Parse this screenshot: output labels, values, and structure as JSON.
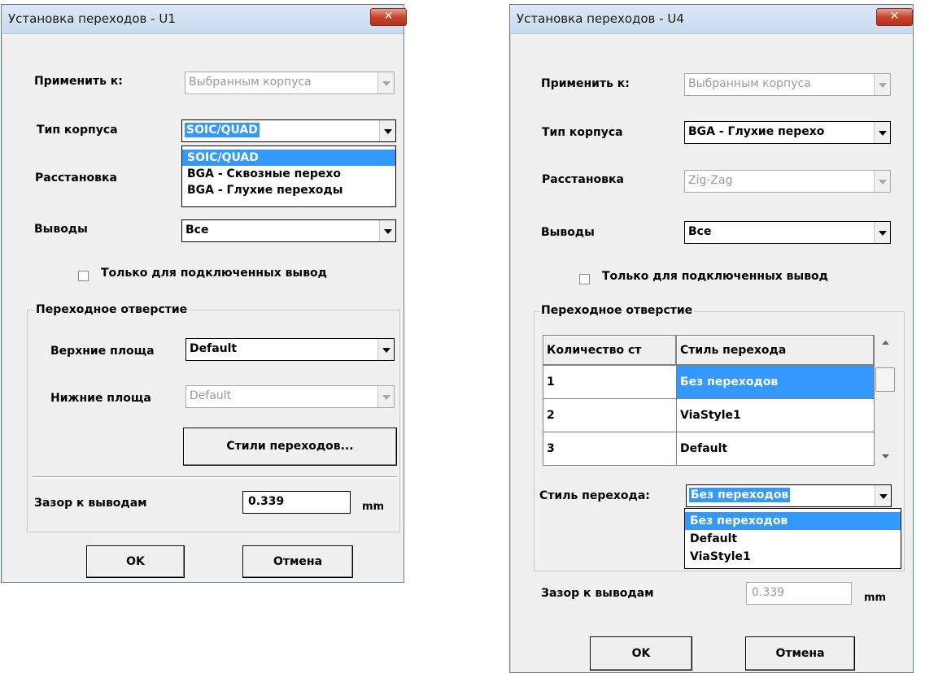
{
  "left_dialog": {
    "title": "Установка переходов - U1",
    "close_label": "✕",
    "apply_to": {
      "label": "Применить к:",
      "value": "Выбранным корпуса"
    },
    "package_type": {
      "label": "Тип корпуса",
      "value": "SOIC/QUAD",
      "options": [
        "SOIC/QUAD",
        "BGA - Сквозные перехо",
        "BGA - Глухие переходы"
      ]
    },
    "placement": {
      "label": "Расстановка"
    },
    "pins": {
      "label": "Выводы",
      "value": "Все"
    },
    "only_connected": {
      "label": "Только для подключенных вывод",
      "checked": false
    },
    "via_group": {
      "title": "Переходное отверстие",
      "top_pads": {
        "label": "Верхние площа",
        "value": "Default"
      },
      "bottom_pads": {
        "label": "Нижние площа",
        "value": "Default"
      },
      "styles_button": "Стили переходов..."
    },
    "clearance": {
      "label": "Зазор к выводам",
      "value": "0.339",
      "unit": "mm"
    },
    "ok_label": "OK",
    "cancel_label": "Отмена"
  },
  "right_dialog": {
    "title": "Установка переходов - U4",
    "close_label": "✕",
    "apply_to": {
      "label": "Применить к:",
      "value": "Выбранным корпуса"
    },
    "package_type": {
      "label": "Тип корпуса",
      "value": "BGA - Глухие перехо"
    },
    "placement": {
      "label": "Расстановка",
      "value": "Zig-Zag"
    },
    "pins": {
      "label": "Выводы",
      "value": "Все"
    },
    "only_connected": {
      "label": "Только для подключенных вывод",
      "checked": false
    },
    "via_group": {
      "title": "Переходное отверстие",
      "columns": [
        "Количество ст",
        "Стиль перехода"
      ],
      "rows": [
        {
          "count": "1",
          "style": "Без переходов"
        },
        {
          "count": "2",
          "style": "ViaStyle1"
        },
        {
          "count": "3",
          "style": "Default"
        }
      ],
      "via_style": {
        "label": "Стиль перехода:",
        "value": "Без переходов",
        "options": [
          "Без переходов",
          "Default",
          "ViaStyle1"
        ]
      }
    },
    "clearance": {
      "label": "Зазор к выводам",
      "value": "0.339",
      "unit": "mm"
    },
    "ok_label": "OK",
    "cancel_label": "Отмена"
  },
  "colors": {
    "selection": "#3399ff",
    "dialog_bg": "#f0f0f0",
    "close_button": "#c8452d"
  }
}
